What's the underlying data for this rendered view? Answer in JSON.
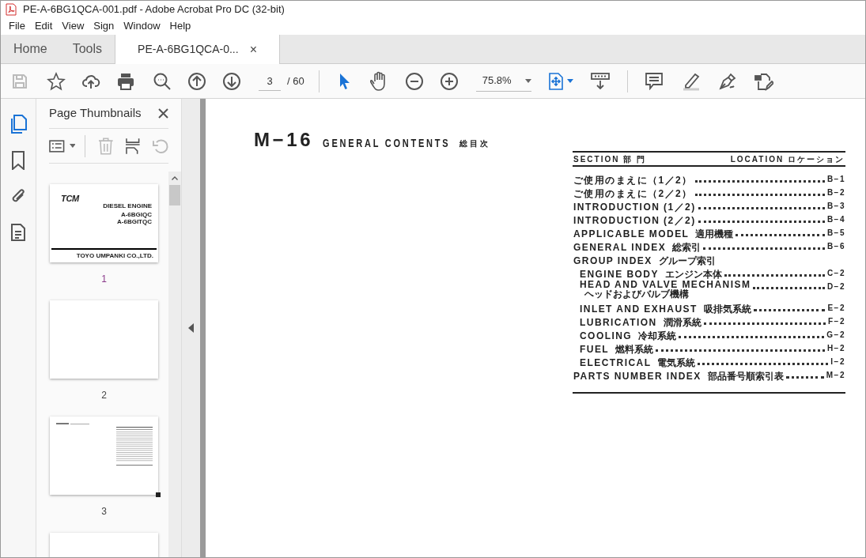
{
  "window": {
    "title": "PE-A-6BG1QCA-001.pdf - Adobe Acrobat Pro DC (32-bit)"
  },
  "menu": [
    "File",
    "Edit",
    "View",
    "Sign",
    "Window",
    "Help"
  ],
  "tabs": [
    {
      "label": "Home",
      "selected": false
    },
    {
      "label": "Tools",
      "selected": false
    },
    {
      "label": "PE-A-6BG1QCA-0...",
      "selected": true,
      "close": "×"
    }
  ],
  "toolbar": {
    "page_current": "3",
    "page_total": "/ 60",
    "zoom": "75.8%"
  },
  "sidebar": {
    "title": "Page Thumbnails",
    "thumbnails": [
      {
        "label": "1",
        "kind": "cover",
        "current": false,
        "texts": [
          "TCM",
          "DIESEL ENGINE",
          "A-6BGIQC",
          "A-6BGITQC",
          "TOYO UMPANKI CO.,LTD."
        ]
      },
      {
        "label": "2",
        "kind": "blank",
        "current": false
      },
      {
        "label": "3",
        "kind": "contents",
        "current": true
      },
      {
        "kind": "partial"
      }
    ]
  },
  "document": {
    "heading": "M−16",
    "subtitle": "GENERAL CONTENTS",
    "subtitle_jp": "総 目 次",
    "columns": [
      "SECTION 部 門",
      "LOCATION ロケーション"
    ],
    "entries": [
      {
        "label": "ご使用のまえに（1／2）",
        "location": "B−1"
      },
      {
        "label": "ご使用のまえに（2／2）",
        "location": "B−2"
      },
      {
        "label": "INTRODUCTION (1／2)",
        "location": "B−3"
      },
      {
        "label": "INTRODUCTION (2／2)",
        "location": "B−4"
      },
      {
        "label": "APPLICABLE MODEL",
        "label_jp": "適用機種",
        "location": "B−5"
      },
      {
        "label": "GENERAL INDEX",
        "label_jp": "総索引",
        "location": "B−6"
      },
      {
        "label": "GROUP INDEX",
        "label_jp": "グループ索引",
        "children": [
          {
            "label": "ENGINE BODY",
            "label_jp": "エンジン本体",
            "location": "C−2"
          },
          {
            "label": "HEAD AND VALVE MECHANISM",
            "sub": "ヘッドおよびバルブ機構",
            "location": "D−2"
          },
          {
            "label": "INLET AND EXHAUST",
            "label_jp": "吸排気系統",
            "location": "E−2"
          },
          {
            "label": "LUBRICATION",
            "label_jp": "潤滑系統",
            "location": "F−2"
          },
          {
            "label": "COOLING",
            "label_jp": "冷却系統",
            "location": "G−2"
          },
          {
            "label": "FUEL",
            "label_jp": "燃料系統",
            "location": "H−2"
          },
          {
            "label": "ELECTRICAL",
            "label_jp": "電気系統",
            "location": "I−2"
          }
        ]
      },
      {
        "label": "PARTS NUMBER INDEX",
        "label_jp": "部品番号順索引表",
        "location": "M−2"
      }
    ]
  }
}
